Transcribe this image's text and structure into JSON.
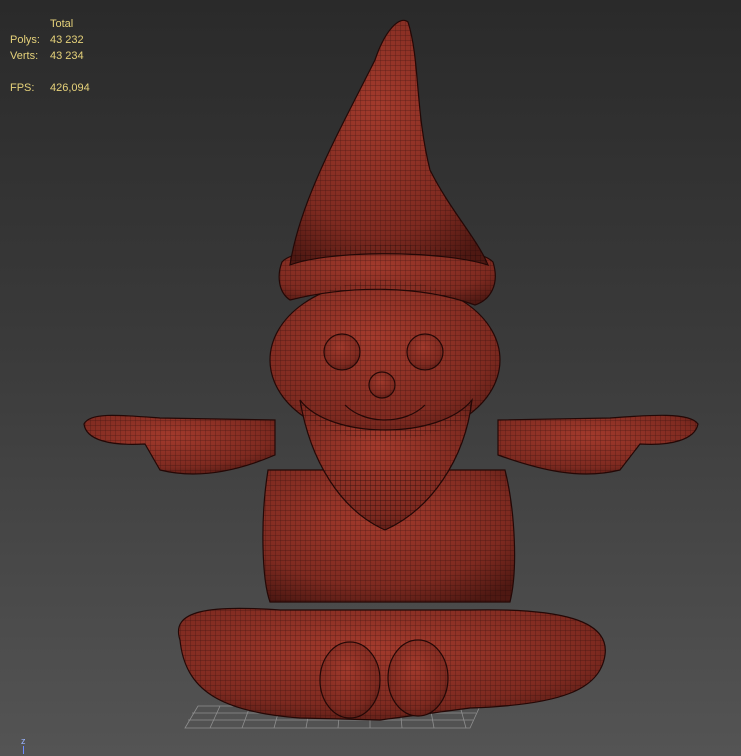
{
  "stats": {
    "header": "Total",
    "polys_label": "Polys:",
    "polys_value": "43 232",
    "verts_label": "Verts:",
    "verts_value": "43 234",
    "fps_label": "FPS:",
    "fps_value": "426,094"
  },
  "gizmo": {
    "axis_label": "z"
  },
  "colors": {
    "viewport_top": "#2a2a2a",
    "viewport_bottom": "#545454",
    "stats_text": "#e6d27a",
    "mesh_fill": "#8a2f24",
    "mesh_wire": "#1a0605"
  }
}
